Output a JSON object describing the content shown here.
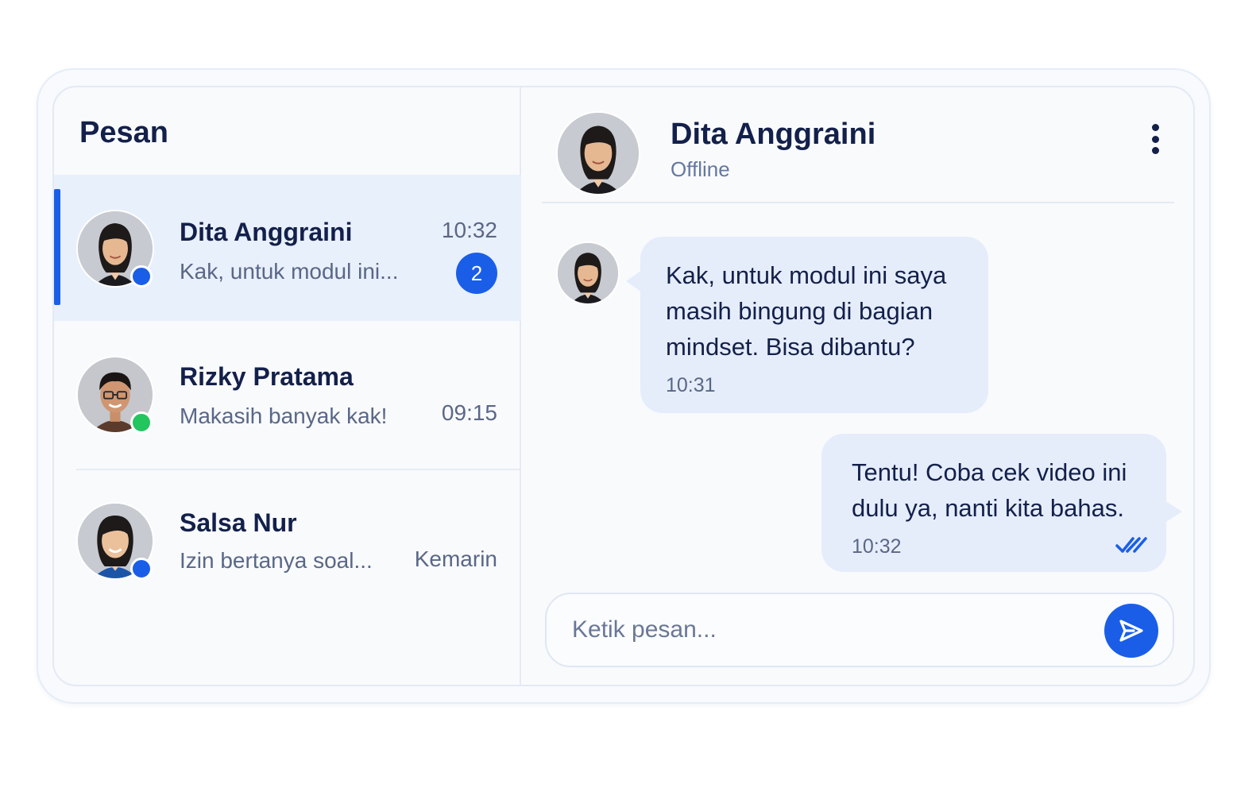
{
  "sidebar": {
    "title": "Pesan",
    "conversations": [
      {
        "name": "Dita Anggraini",
        "preview": "Kak, untuk modul ini...",
        "time": "10:32",
        "unread": "2",
        "status_color": "#1a5ee8",
        "active": true
      },
      {
        "name": "Rizky Pratama",
        "preview": "Makasih banyak kak!",
        "time": "09:15",
        "unread": "",
        "status_color": "#22c55e",
        "active": false
      },
      {
        "name": "Salsa Nur",
        "preview": "Izin bertanya soal...",
        "time": "Kemarin",
        "unread": "",
        "status_color": "#1a5ee8",
        "active": false
      }
    ]
  },
  "chat": {
    "contact_name": "Dita Anggraini",
    "contact_status": "Offline",
    "messages": [
      {
        "direction": "incoming",
        "text": "Kak, untuk modul ini saya masih bingung di bagian mindset. Bisa dibantu?",
        "time": "10:31"
      },
      {
        "direction": "outgoing",
        "text": "Tentu! Coba cek video ini dulu ya, nanti kita bahas.",
        "time": "10:32",
        "read": true
      }
    ],
    "input": {
      "placeholder": "Ketik pesan...",
      "value": ""
    }
  },
  "icons": {
    "more": "more-vertical-icon",
    "send": "send-icon",
    "read_receipt": "double-check-icon"
  },
  "colors": {
    "accent": "#1a5ee8",
    "online": "#22c55e",
    "bubble": "#e5edfb",
    "active_row": "#e8f0fc",
    "text_dark": "#13204a",
    "text_muted": "#5a6786"
  }
}
